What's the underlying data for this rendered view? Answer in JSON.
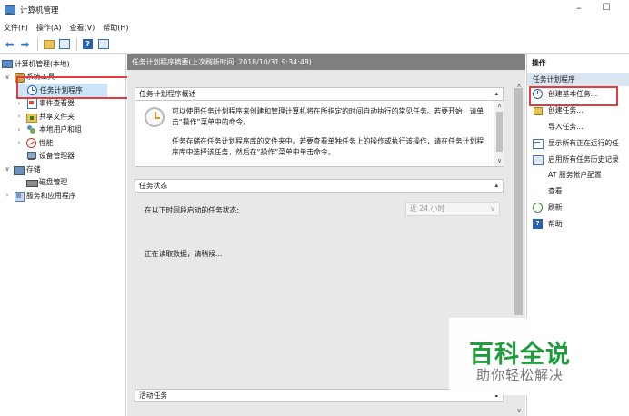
{
  "window": {
    "title": "计算机管理",
    "minimize": "–",
    "maximize": "☐"
  },
  "menu": [
    "文件(F)",
    "操作(A)",
    "查看(V)",
    "帮助(H)"
  ],
  "tree": {
    "items": [
      {
        "label": "计算机管理(本地)",
        "icon": "computer-icon",
        "level": 0,
        "chevron": ""
      },
      {
        "label": "系统工具",
        "icon": "tools-icon",
        "level": 1,
        "chevron": "expanded"
      },
      {
        "label": "任务计划程序",
        "icon": "clock-icon",
        "level": 2,
        "chevron": "",
        "selected": true
      },
      {
        "label": "事件查看器",
        "icon": "event-log-icon",
        "level": 2,
        "chevron": "collapsed"
      },
      {
        "label": "共享文件夹",
        "icon": "shared-folder-icon",
        "level": 2,
        "chevron": "collapsed"
      },
      {
        "label": "本地用户和组",
        "icon": "users-icon",
        "level": 2,
        "chevron": "collapsed"
      },
      {
        "label": "性能",
        "icon": "performance-icon",
        "level": 2,
        "chevron": "collapsed"
      },
      {
        "label": "设备管理器",
        "icon": "device-manager-icon",
        "level": 2,
        "chevron": ""
      },
      {
        "label": "存储",
        "icon": "storage-icon",
        "level": 1,
        "chevron": "expanded"
      },
      {
        "label": "磁盘管理",
        "icon": "disk-icon",
        "level": 2,
        "chevron": ""
      },
      {
        "label": "服务和应用程序",
        "icon": "services-icon",
        "level": 1,
        "chevron": "collapsed"
      }
    ]
  },
  "center": {
    "header": "任务计划程序摘要(上次刷新时间: 2018/10/31 9:34:48)",
    "overview": {
      "title": "任务计划程序概述",
      "paragraph1": "可以使用任务计划程序来创建和管理计算机将在所指定的时间自动执行的常见任务。若要开始，请单击“操作”菜单中的命令。",
      "paragraph2": "任务存储在任务计划程序库的文件夹中。若要查看单独任务上的操作或执行该操作，请在任务计划程序库中选择该任务，然后在“操作”菜单中单击命令。"
    },
    "status": {
      "title": "任务状态",
      "label": "在以下时间段启动的任务状态:",
      "select_value": "近 24 小时",
      "loading": "正在读取数据，请稍候..."
    },
    "active": {
      "title": "活动任务"
    }
  },
  "actions": {
    "header": "操作",
    "group": "任务计划程序",
    "items": [
      {
        "label": "创建基本任务...",
        "icon": "create-basic-task-icon"
      },
      {
        "label": "创建任务...",
        "icon": "create-task-icon"
      },
      {
        "label": "导入任务...",
        "icon": ""
      },
      {
        "label": "显示所有正在运行的任",
        "icon": "running-tasks-icon"
      },
      {
        "label": "启用所有任务历史记录",
        "icon": "task-history-icon"
      },
      {
        "label": "AT 服务帐户配置",
        "icon": ""
      },
      {
        "label": "查看",
        "icon": ""
      },
      {
        "label": "刷新",
        "icon": "refresh-icon"
      },
      {
        "label": "帮助",
        "icon": "help-icon"
      }
    ]
  },
  "watermark": {
    "main": "百科全说",
    "sub": "助你轻松解决"
  },
  "colors": {
    "highlight_box": "#e23c3c",
    "selection": "#cce4f7",
    "watermark_green": "#1f9c3c"
  }
}
